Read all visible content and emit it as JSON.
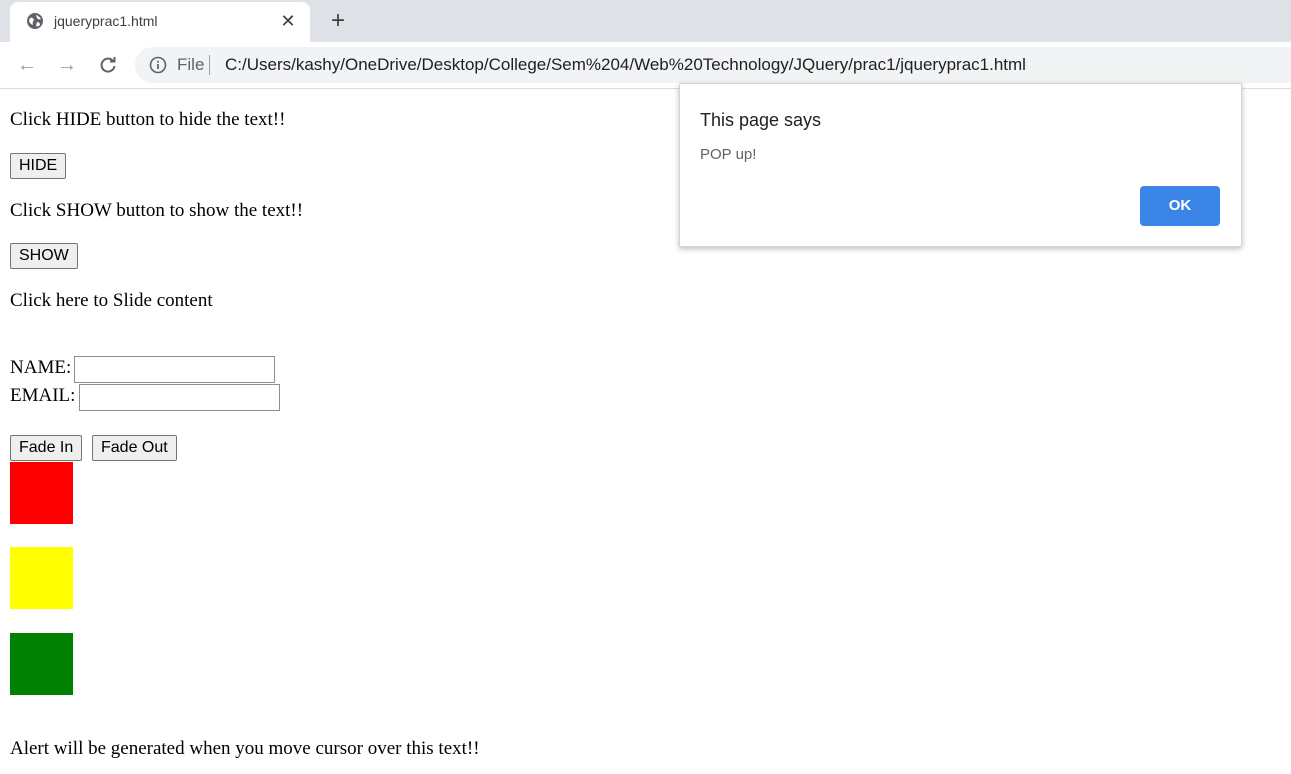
{
  "browser": {
    "tab": {
      "title": "jqueryprac1.html",
      "close_glyph": "✕",
      "favicon": "globe-icon"
    },
    "new_tab_glyph": "+",
    "toolbar": {
      "back_glyph": "←",
      "forward_glyph": "→",
      "reload_glyph": "↻",
      "scheme_label": "File",
      "url": "C:/Users/kashy/OneDrive/Desktop/College/Sem%204/Web%20Technology/JQuery/prac1/jqueryprac1.html"
    }
  },
  "page": {
    "hide_prompt": "Click HIDE button to hide the text!!",
    "hide_button": "HIDE",
    "show_prompt": "Click SHOW button to show the text!!",
    "show_button": "SHOW",
    "slide_prompt": "Click here to Slide content",
    "name_label": "NAME:",
    "name_value": "",
    "email_label": "EMAIL:",
    "email_value": "",
    "fade_in_button": "Fade In",
    "fade_out_button": "Fade Out",
    "boxes": [
      {
        "color": "#ff0000"
      },
      {
        "color": "#ffff00"
      },
      {
        "color": "#008000"
      }
    ],
    "hover_alert_text": "Alert will be generated when you move cursor over this text!!"
  },
  "dialog": {
    "title": "This page says",
    "message": "POP up!",
    "ok_button": "OK",
    "ok_color": "#3b84e8"
  }
}
